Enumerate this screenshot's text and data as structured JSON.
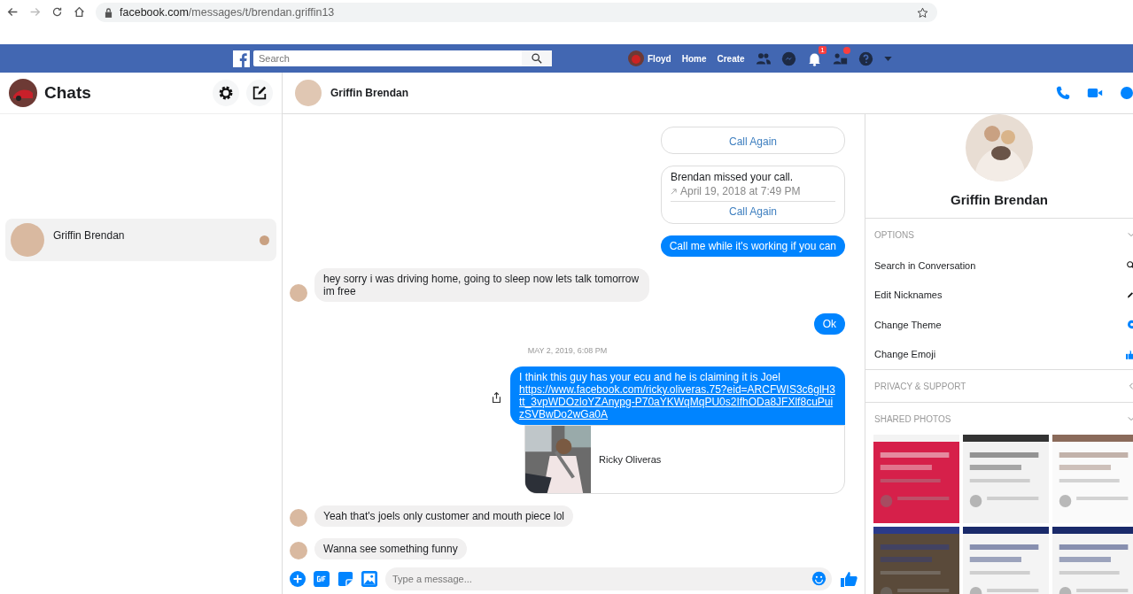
{
  "browser": {
    "url_host": "facebook.com",
    "url_path": "/messages/t/brendan.griffin13"
  },
  "topbar": {
    "search": {
      "placeholder": "Search"
    },
    "profile": "Floyd",
    "links": [
      "Home",
      "Create"
    ],
    "notification_count": "1"
  },
  "chats": {
    "title": "Chats",
    "conversations": [
      {
        "name": "Griffin Brendan",
        "selected": true
      }
    ]
  },
  "conversation": {
    "name": "Griffin Brendan",
    "messages": [
      {
        "kind": "call_card",
        "action": "Call Again"
      },
      {
        "kind": "call_card",
        "text": "Brendan missed your call.",
        "time": "April 19, 2018 at 7:49 PM",
        "action": "Call Again"
      },
      {
        "kind": "outgoing",
        "text": "Call me while it's working if you can"
      },
      {
        "kind": "incoming",
        "text": "hey sorry i was driving home, going to sleep now lets talk tomorrow im free"
      },
      {
        "kind": "outgoing",
        "text": "Ok"
      },
      {
        "kind": "divider",
        "text": "MAY 2, 2019, 6:08 PM"
      },
      {
        "kind": "outgoing_link",
        "text": "I think this guy has your ecu and he is claiming it is Joel",
        "link": "https://www.facebook.com/ricky.oliveras.75?eid=ARCFWIS3c6glH3tt_3vpWDOzloYZAnypg-P70aYKWqMqPU0s2IfhODa8JFXlf8cuPuizSVBwDo2wGa0A",
        "preview_title": "Ricky Oliveras"
      },
      {
        "kind": "incoming",
        "text": "Yeah that's joels only customer and mouth piece lol"
      },
      {
        "kind": "incoming",
        "text": "Wanna see something funny"
      }
    ],
    "composer": {
      "placeholder": "Type a message..."
    }
  },
  "info": {
    "name": "Griffin Brendan",
    "sections": [
      {
        "title": "OPTIONS",
        "expanded": true,
        "items": [
          "Search in Conversation",
          "Edit Nicknames",
          "Change Theme",
          "Change Emoji"
        ]
      },
      {
        "title": "PRIVACY & SUPPORT",
        "expanded": false
      },
      {
        "title": "SHARED PHOTOS",
        "expanded": true
      }
    ]
  }
}
